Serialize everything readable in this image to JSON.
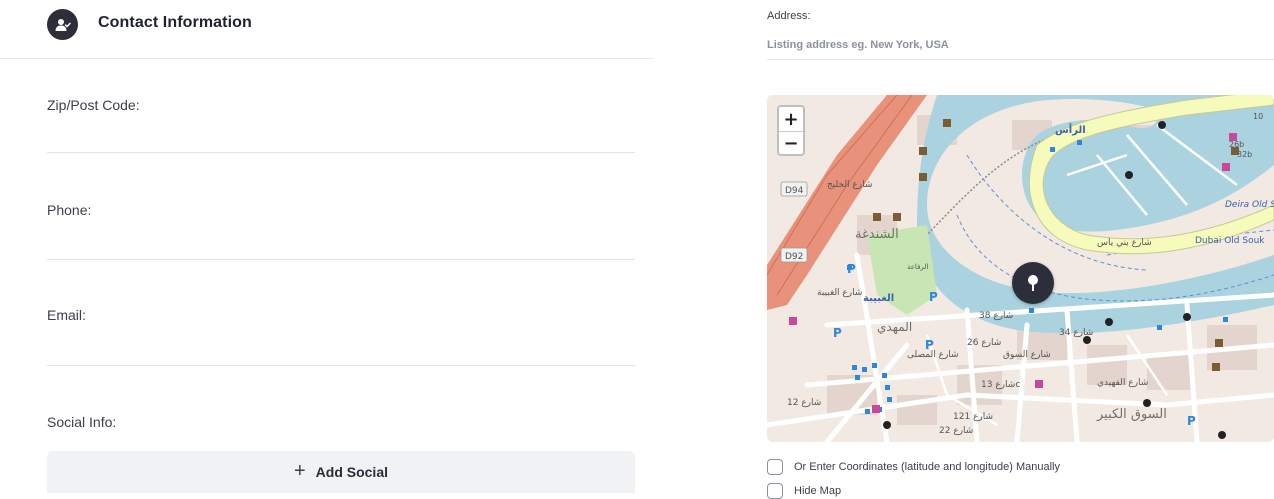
{
  "section": {
    "title": "Contact Information",
    "icon": "user-check-icon"
  },
  "fields": {
    "zip": {
      "label": "Zip/Post Code:",
      "value": ""
    },
    "phone": {
      "label": "Phone:",
      "value": ""
    },
    "email": {
      "label": "Email:",
      "value": ""
    },
    "social": {
      "label": "Social Info:"
    }
  },
  "add_social": {
    "label": "Add Social",
    "icon": "plus-icon"
  },
  "address": {
    "label": "Address:",
    "placeholder": "Listing address eg. New York, USA",
    "value": ""
  },
  "map": {
    "zoom_in": "+",
    "zoom_out": "−",
    "pin_icon": "map-pin-icon",
    "labels": {
      "road_d94": "D94",
      "road_d92": "D92",
      "shindagha": "الشندغة",
      "ghubaiba": "الغبيبة",
      "raffa": "الرفاعة",
      "mahdi": "المهدي",
      "ras": "الرأس",
      "deira_old_souk": "Deira Old Souk",
      "dubai_old_souk": "Dubai Old Souk",
      "souk_kabir": "السوق الكبير",
      "st_38": "شارع 38",
      "st_26": "شارع 26",
      "st_34": "شارع 34",
      "st_13": "شارع 13c",
      "st_12": "شارع 12",
      "st_121": "شارع 121",
      "st_22": "شارع 22",
      "st_bani_yas": "شارع بني ياس",
      "st_khaleej": "شارع الخليج",
      "st_souk": "شارع السوق",
      "st_ghubaiba": "شارع الغبيبة",
      "st_musalla": "شارع المصلى",
      "st_fahidi": "شارع الفهيدي",
      "road_26b": "26b",
      "road_32b": "32b",
      "road_10": "10"
    },
    "colors": {
      "water": "#aad3df",
      "land": "#f2e9e3",
      "highway": "#e8927c",
      "primary": "#f6fabb",
      "park": "#c8e6b4"
    }
  },
  "options": {
    "manual_coords": {
      "label": "Or Enter Coordinates (latitude and longitude) Manually",
      "checked": false
    },
    "hide_map": {
      "label": "Hide Map",
      "checked": false
    }
  }
}
